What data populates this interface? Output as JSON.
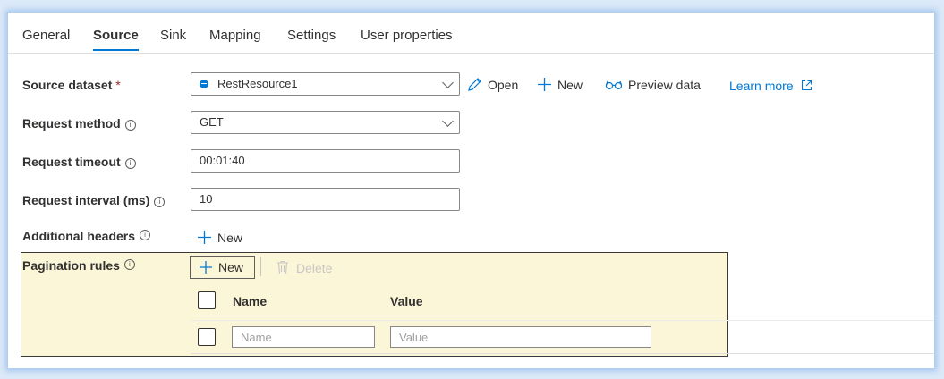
{
  "tabs": [
    {
      "label": "General",
      "active": false
    },
    {
      "label": "Source",
      "active": true
    },
    {
      "label": "Sink",
      "active": false
    },
    {
      "label": "Mapping",
      "active": false
    },
    {
      "label": "Settings",
      "active": false
    },
    {
      "label": "User properties",
      "active": false
    }
  ],
  "source_dataset": {
    "label": "Source dataset",
    "required_mark": "*",
    "value": "RestResource1",
    "open_label": "Open",
    "new_label": "New",
    "preview_label": "Preview data",
    "learn_more_label": "Learn more"
  },
  "request_method": {
    "label": "Request method",
    "value": "GET"
  },
  "request_timeout": {
    "label": "Request timeout",
    "value": "00:01:40"
  },
  "request_interval": {
    "label": "Request interval (ms)",
    "value": "10"
  },
  "additional_headers": {
    "label": "Additional headers",
    "new_label": "New"
  },
  "pagination_rules": {
    "label": "Pagination rules",
    "new_label": "New",
    "delete_label": "Delete",
    "columns": {
      "name": "Name",
      "value": "Value"
    },
    "row": {
      "name_placeholder": "Name",
      "value_placeholder": "Value"
    }
  },
  "icons": {
    "info": "info-icon",
    "open": "pencil-icon",
    "new": "plus-icon",
    "preview": "glasses-icon",
    "external": "external-link-icon",
    "delete": "trash-icon",
    "dataset": "rest-dataset-icon"
  },
  "colors": {
    "accent": "#0078d4",
    "highlight": "#fcf6d9",
    "required": "#a4262c"
  }
}
